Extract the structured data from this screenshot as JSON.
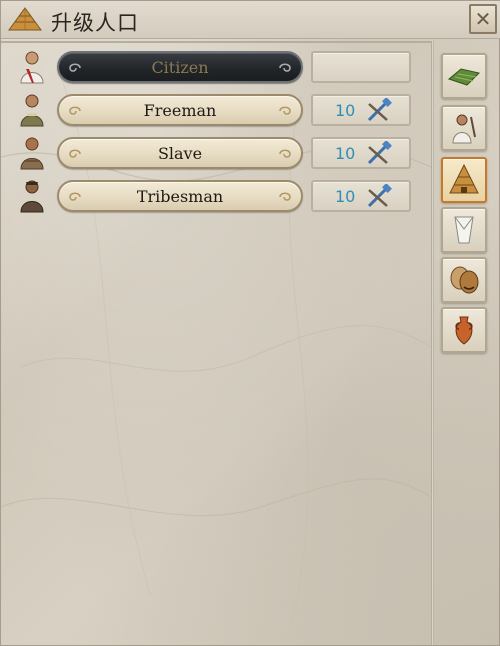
{
  "window": {
    "title": "升级人口",
    "close_label": "✕"
  },
  "rows": [
    {
      "label": "Citizen",
      "cost": "",
      "enabled": false,
      "icon": "citizen-portrait"
    },
    {
      "label": "Freeman",
      "cost": "10",
      "enabled": true,
      "icon": "freeman-portrait"
    },
    {
      "label": "Slave",
      "cost": "10",
      "enabled": true,
      "icon": "slave-portrait"
    },
    {
      "label": "Tribesman",
      "cost": "10",
      "enabled": true,
      "icon": "tribesman-portrait"
    }
  ],
  "sidebar": {
    "tabs": [
      {
        "name": "farmland-icon",
        "active": false
      },
      {
        "name": "worker-icon",
        "active": false
      },
      {
        "name": "pyramid-icon",
        "active": true
      },
      {
        "name": "toga-icon",
        "active": false
      },
      {
        "name": "theater-masks-icon",
        "active": false
      },
      {
        "name": "amphora-icon",
        "active": false
      }
    ]
  },
  "colors": {
    "cost_text": "#2f8fb5",
    "active_tab_border": "#c57a2a",
    "disabled_label": "#8a7a52"
  }
}
